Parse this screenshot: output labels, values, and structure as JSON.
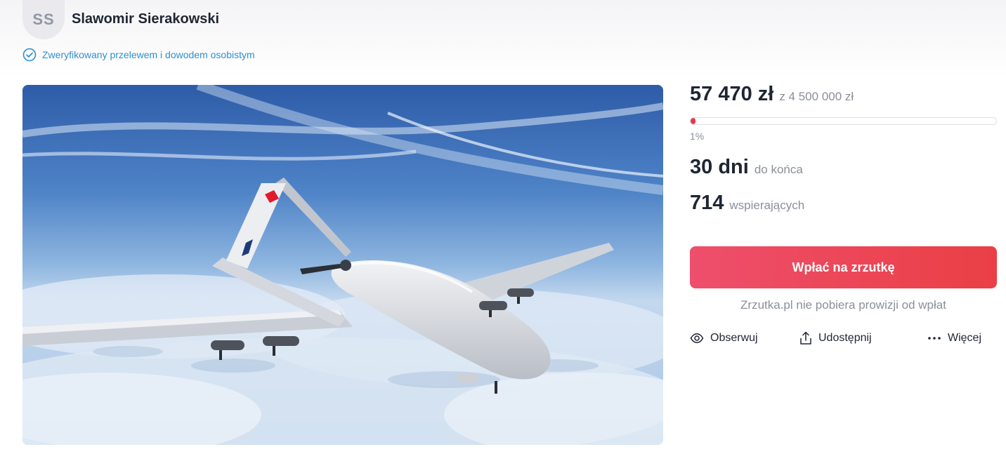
{
  "author": {
    "initials": "SS",
    "name": "Slawomir Sierakowski",
    "verified_text": "Zweryfikowany przelewem i dowodem osobistym"
  },
  "fundraiser": {
    "raised": "57 470 zł",
    "goal": "z 4 500 000 zł",
    "progress_fraction": 0.01,
    "percent_label": "1%",
    "days_value": "30 dni",
    "days_label": "do końca",
    "supporters_value": "714",
    "supporters_label": "wspierających"
  },
  "donate_button": {
    "label": "Wpłać na zrzutkę"
  },
  "fee_note": "Zrzutka.pl nie pobiera prowizji od wpłat",
  "actions": {
    "watch": "Obserwuj",
    "share": "Udostępnij",
    "more": "Więcej"
  },
  "icons": {
    "verified": "check-circle-icon",
    "watch": "eye-icon",
    "share": "share-icon",
    "more": "more-dots-icon"
  },
  "colors": {
    "accent": "#e8364f",
    "verified": "#2f8fd0",
    "muted_text": "#8a8f99",
    "primary_text": "#1f2533"
  }
}
